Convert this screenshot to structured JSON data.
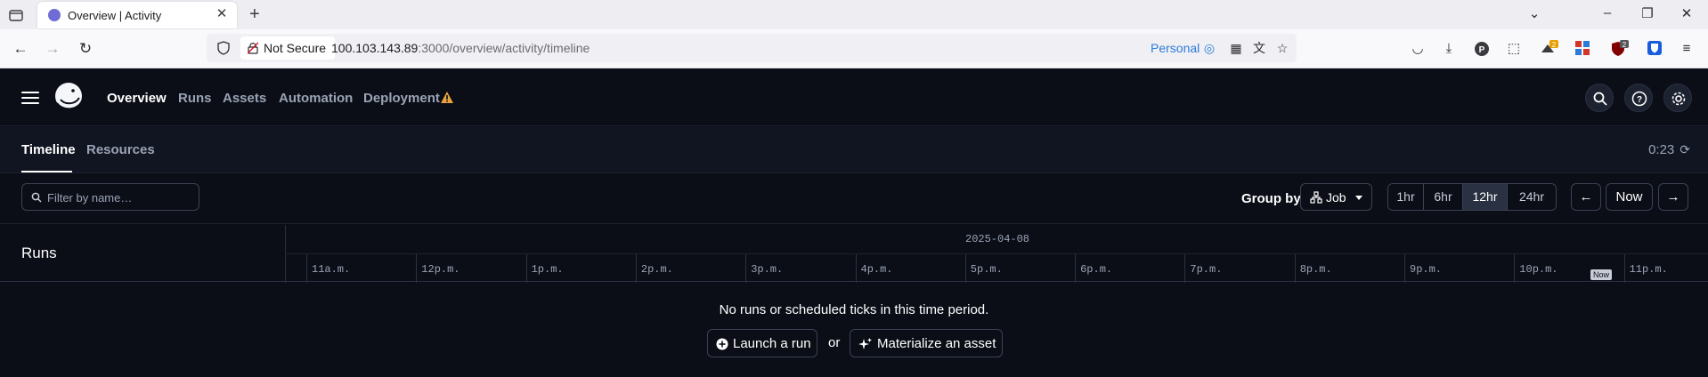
{
  "browser": {
    "tab_title": "Overview | Activity",
    "url_host": "100.103.143.89",
    "url_rest": ":3000/overview/activity/timeline",
    "not_secure": "Not Secure",
    "container_label": "Personal",
    "ublock_count": "2",
    "ext_badge_count": "2"
  },
  "nav": {
    "items": [
      {
        "label": "Overview",
        "active": true
      },
      {
        "label": "Runs"
      },
      {
        "label": "Assets"
      },
      {
        "label": "Automation"
      },
      {
        "label": "Deployment"
      }
    ]
  },
  "subnav": {
    "tabs": [
      {
        "label": "Timeline"
      },
      {
        "label": "Resources"
      }
    ],
    "refresh_timer": "0:23"
  },
  "filters": {
    "search_placeholder": "Filter by name…",
    "group_by_label": "Group by",
    "group_by_value": "Job",
    "ranges": [
      "1hr",
      "6hr",
      "12hr",
      "24hr"
    ],
    "active_range": "12hr",
    "now_label": "Now"
  },
  "timeline": {
    "runs_label": "Runs",
    "date": "2025-04-08",
    "hours": [
      "11a.m.",
      "12p.m.",
      "1p.m.",
      "2p.m.",
      "3p.m.",
      "4p.m.",
      "5p.m.",
      "6p.m.",
      "7p.m.",
      "8p.m.",
      "9p.m.",
      "10p.m.",
      "11p.m."
    ],
    "now_badge": "Now"
  },
  "empty_state": {
    "message": "No runs or scheduled ticks in this time period.",
    "launch_label": "Launch a run",
    "or_label": "or",
    "materialize_label": "Materialize an asset"
  }
}
